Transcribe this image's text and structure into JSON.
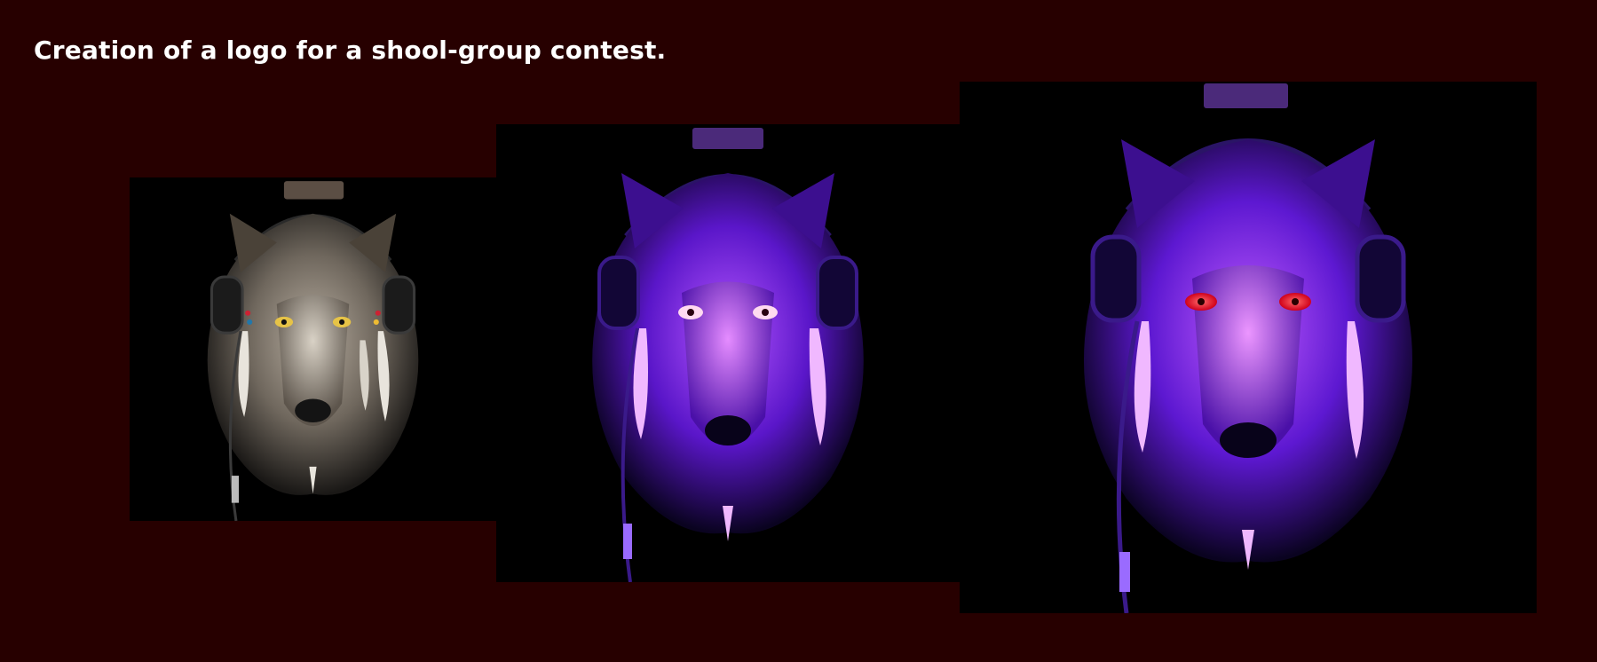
{
  "title": "Creation of a logo for a shool-group contest.",
  "panels": [
    {
      "icon": "wolf-with-headphones-original-icon",
      "palette": "natural-grey"
    },
    {
      "icon": "wolf-with-headphones-purple-icon",
      "palette": "purple"
    },
    {
      "icon": "wolf-with-headphones-purple-red-eyes-icon",
      "palette": "purple-red-eyes"
    }
  ],
  "colors": {
    "background": "#270000",
    "panel": "#000000",
    "title": "#ffffff",
    "fur_grey": "#8a8378",
    "fur_purple": "#7a22e6",
    "fur_highlight": "#e58cff",
    "eye_gold": "#e6c347",
    "eye_red": "#ff2a3a"
  }
}
